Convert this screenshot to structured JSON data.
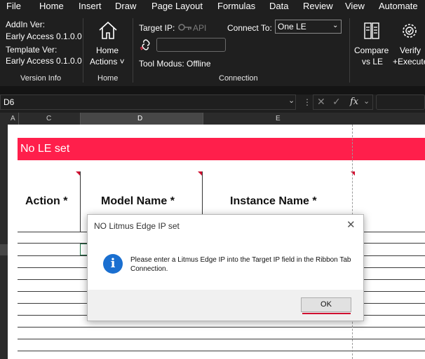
{
  "menu": [
    "File",
    "Home",
    "Insert",
    "Draw",
    "Page Layout",
    "Formulas",
    "Data",
    "Review",
    "View",
    "Automate"
  ],
  "ribbon": {
    "version_info": {
      "addin_label": "AddIn Ver:",
      "addin_value": "Early Access 0.1.0.0",
      "template_label": "Template Ver:",
      "template_value": "Early Access 0.1.0.0",
      "group_label": "Version Info"
    },
    "home": {
      "line1": "Home",
      "line2": "Actions ˅",
      "group_label": "Home"
    },
    "connection": {
      "target_ip_label": "Target IP:",
      "api_label": "API",
      "connect_to_label": "Connect To:",
      "connect_to_value": "One LE",
      "tool_modus": "Tool Modus: Offline",
      "group_label": "Connection"
    },
    "compare": {
      "line1": "Compare",
      "line2": "vs LE"
    },
    "verify": {
      "line1": "Verify",
      "line2": "+Execute"
    }
  },
  "formula_bar": {
    "cell_ref": "D6",
    "fx": "fx"
  },
  "columns": [
    "A",
    "C",
    "D",
    "E"
  ],
  "sheet": {
    "banner": "No LE set",
    "headers": [
      "Action *",
      "Model Name *",
      "Instance Name *"
    ]
  },
  "dialog": {
    "title": "NO Litmus Edge IP set",
    "message": "Please enter a Litmus Edge IP into the Target IP field in the Ribbon Tab Connection.",
    "ok_label": "OK",
    "close_glyph": "✕",
    "icon_glyph": "i"
  },
  "colors": {
    "banner": "#ff1f4b",
    "info_icon": "#1a6fd0",
    "ribbon_bg": "#1f1f1f"
  }
}
